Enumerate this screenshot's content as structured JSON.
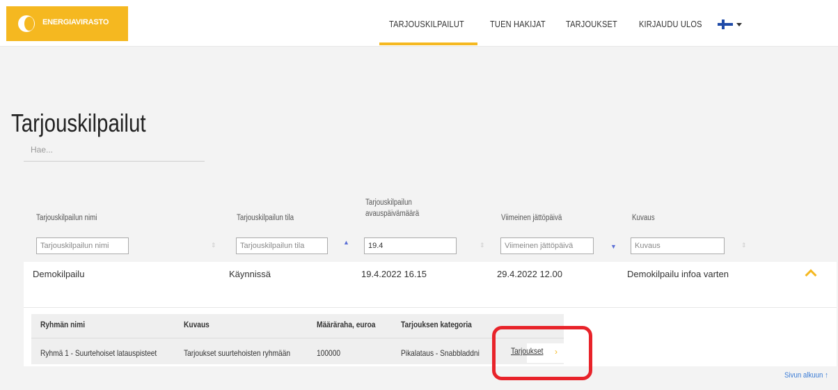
{
  "header": {
    "logo_text": "ENERGIAVIRASTO",
    "nav": [
      {
        "label": "TARJOUSKILPAILUT",
        "active": true
      },
      {
        "label": "TUEN HAKIJAT"
      },
      {
        "label": "TARJOUKSET"
      },
      {
        "label": "KIRJAUDU ULOS"
      }
    ],
    "language_icon": "finland-flag-icon"
  },
  "page": {
    "title": "Tarjouskilpailut",
    "search_placeholder": "Hae..."
  },
  "table": {
    "columns": [
      {
        "label": "Tarjouskilpailun nimi"
      },
      {
        "label": "Tarjouskilpailun tila"
      },
      {
        "label_line1": "Tarjouskilpailun",
        "label_line2": "avauspäivämäärä"
      },
      {
        "label": "Viimeinen jättöpäivä"
      },
      {
        "label": "Kuvaus"
      }
    ],
    "filters": {
      "name_placeholder": "Tarjouskilpailun nimi",
      "status_placeholder": "Tarjouskilpailun tila",
      "open_date_value": "19.4",
      "deadline_placeholder": "Viimeinen jättöpäivä",
      "description_placeholder": "Kuvaus"
    },
    "rows": [
      {
        "name": "Demokilpailu",
        "status": "Käynnissä",
        "open_date": "19.4.2022 16.15",
        "deadline": "29.4.2022 12.00",
        "description": "Demokilpailu infoa varten",
        "expanded": true
      }
    ]
  },
  "subtable": {
    "headers": [
      "Ryhmän nimi",
      "Kuvaus",
      "Määräraha, euroa",
      "Tarjouksen kategoria"
    ],
    "rows": [
      {
        "group_name": "Ryhmä 1 - Suurtehoiset latauspisteet",
        "description": "Tarjoukset suurtehoisten ryhmään",
        "amount": "100000",
        "category": "Pikalataus - Snabbladdni",
        "link": "Tarjoukset"
      }
    ]
  },
  "footer": {
    "back_to_top": "Sivun alkuun ↑"
  },
  "colors": {
    "accent": "#f5b820",
    "highlight": "#e8232a",
    "link": "#3a7bd5"
  }
}
